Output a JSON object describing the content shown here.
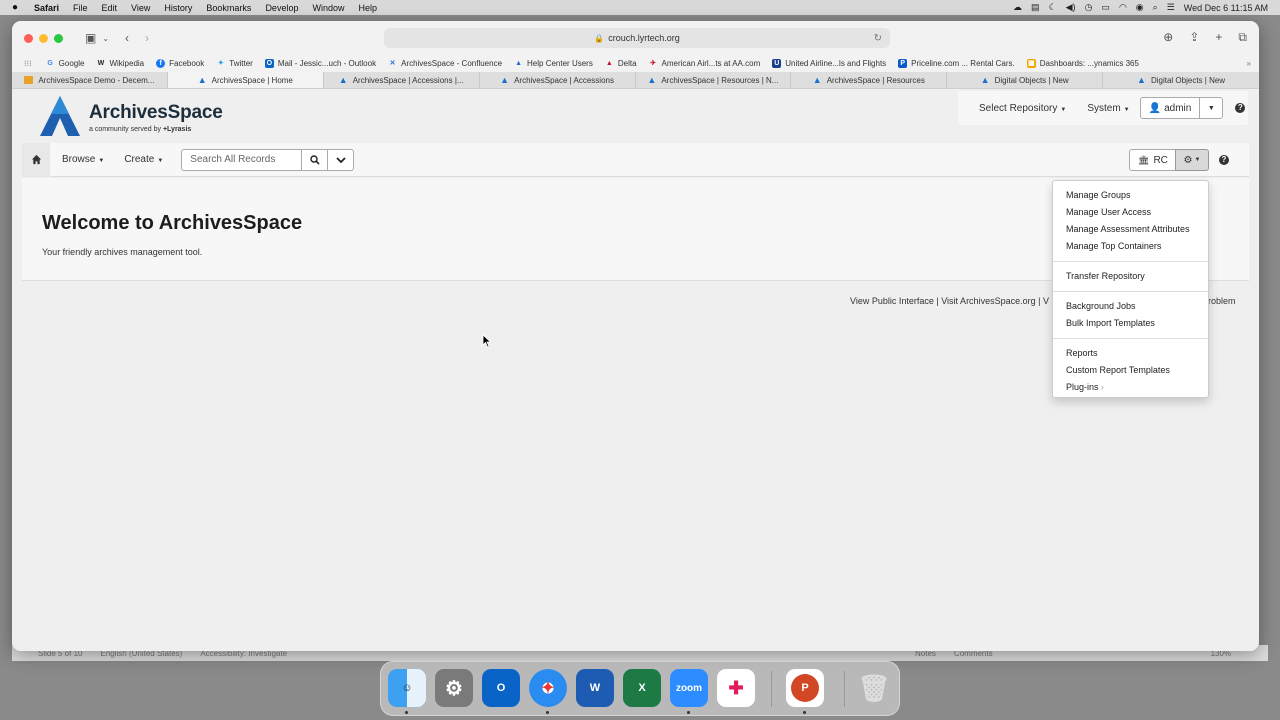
{
  "menubar": {
    "items": [
      "Safari",
      "File",
      "Edit",
      "View",
      "History",
      "Bookmarks",
      "Develop",
      "Window",
      "Help"
    ],
    "clock": "Wed Dec 6  11:15 AM"
  },
  "browser": {
    "url": "crouch.lyrtech.org",
    "favorites": [
      "Google",
      "Wikipedia",
      "Facebook",
      "Twitter",
      "Mail - Jessic...uch - Outlook",
      "ArchivesSpace - Confluence",
      "Help Center Users",
      "Delta",
      "American Airl...ts at AA.com",
      "United Airline...ls and Flights",
      "Priceline.com ... Rental Cars.",
      "Dashboards: ...ynamics 365"
    ],
    "tabs": [
      "ArchivesSpace Demo - Decem...",
      "ArchivesSpace | Home",
      "ArchivesSpace | Accessions |...",
      "ArchivesSpace | Accessions",
      "ArchivesSpace | Resources | N...",
      "ArchivesSpace | Resources",
      "Digital Objects | New",
      "Digital Objects | New"
    ]
  },
  "app": {
    "logo_title": "ArchivesSpace",
    "logo_sub": "a community served by",
    "logo_brand": "Lyrasis",
    "select_repository": "Select Repository",
    "system": "System",
    "user": "admin",
    "help": "?",
    "nav": {
      "browse": "Browse",
      "create": "Create",
      "search_placeholder": "Search All Records",
      "repo": "RC"
    },
    "welcome_title": "Welcome to ArchivesSpace",
    "welcome_sub": "Your friendly archives management tool.",
    "footer": "View Public Interface | Visit ArchivesSpace.org | V",
    "footer_tail": "roblem"
  },
  "dropdown": {
    "group1": [
      "Manage Groups",
      "Manage User Access",
      "Manage Assessment Attributes",
      "Manage Top Containers"
    ],
    "group2": [
      "Transfer Repository"
    ],
    "group3": [
      "Background Jobs",
      "Bulk Import Templates"
    ],
    "group4": [
      "Reports",
      "Custom Report Templates",
      "Plug-ins"
    ]
  },
  "behind": [
    "Slide 5 of 10",
    "English (United States)",
    "Accessibility: Investigate",
    "Notes",
    "Comments",
    "130%"
  ],
  "dock": [
    "finder",
    "system-settings",
    "outlook",
    "safari",
    "word",
    "excel",
    "zoom",
    "slack",
    "powerpoint",
    "trash"
  ]
}
